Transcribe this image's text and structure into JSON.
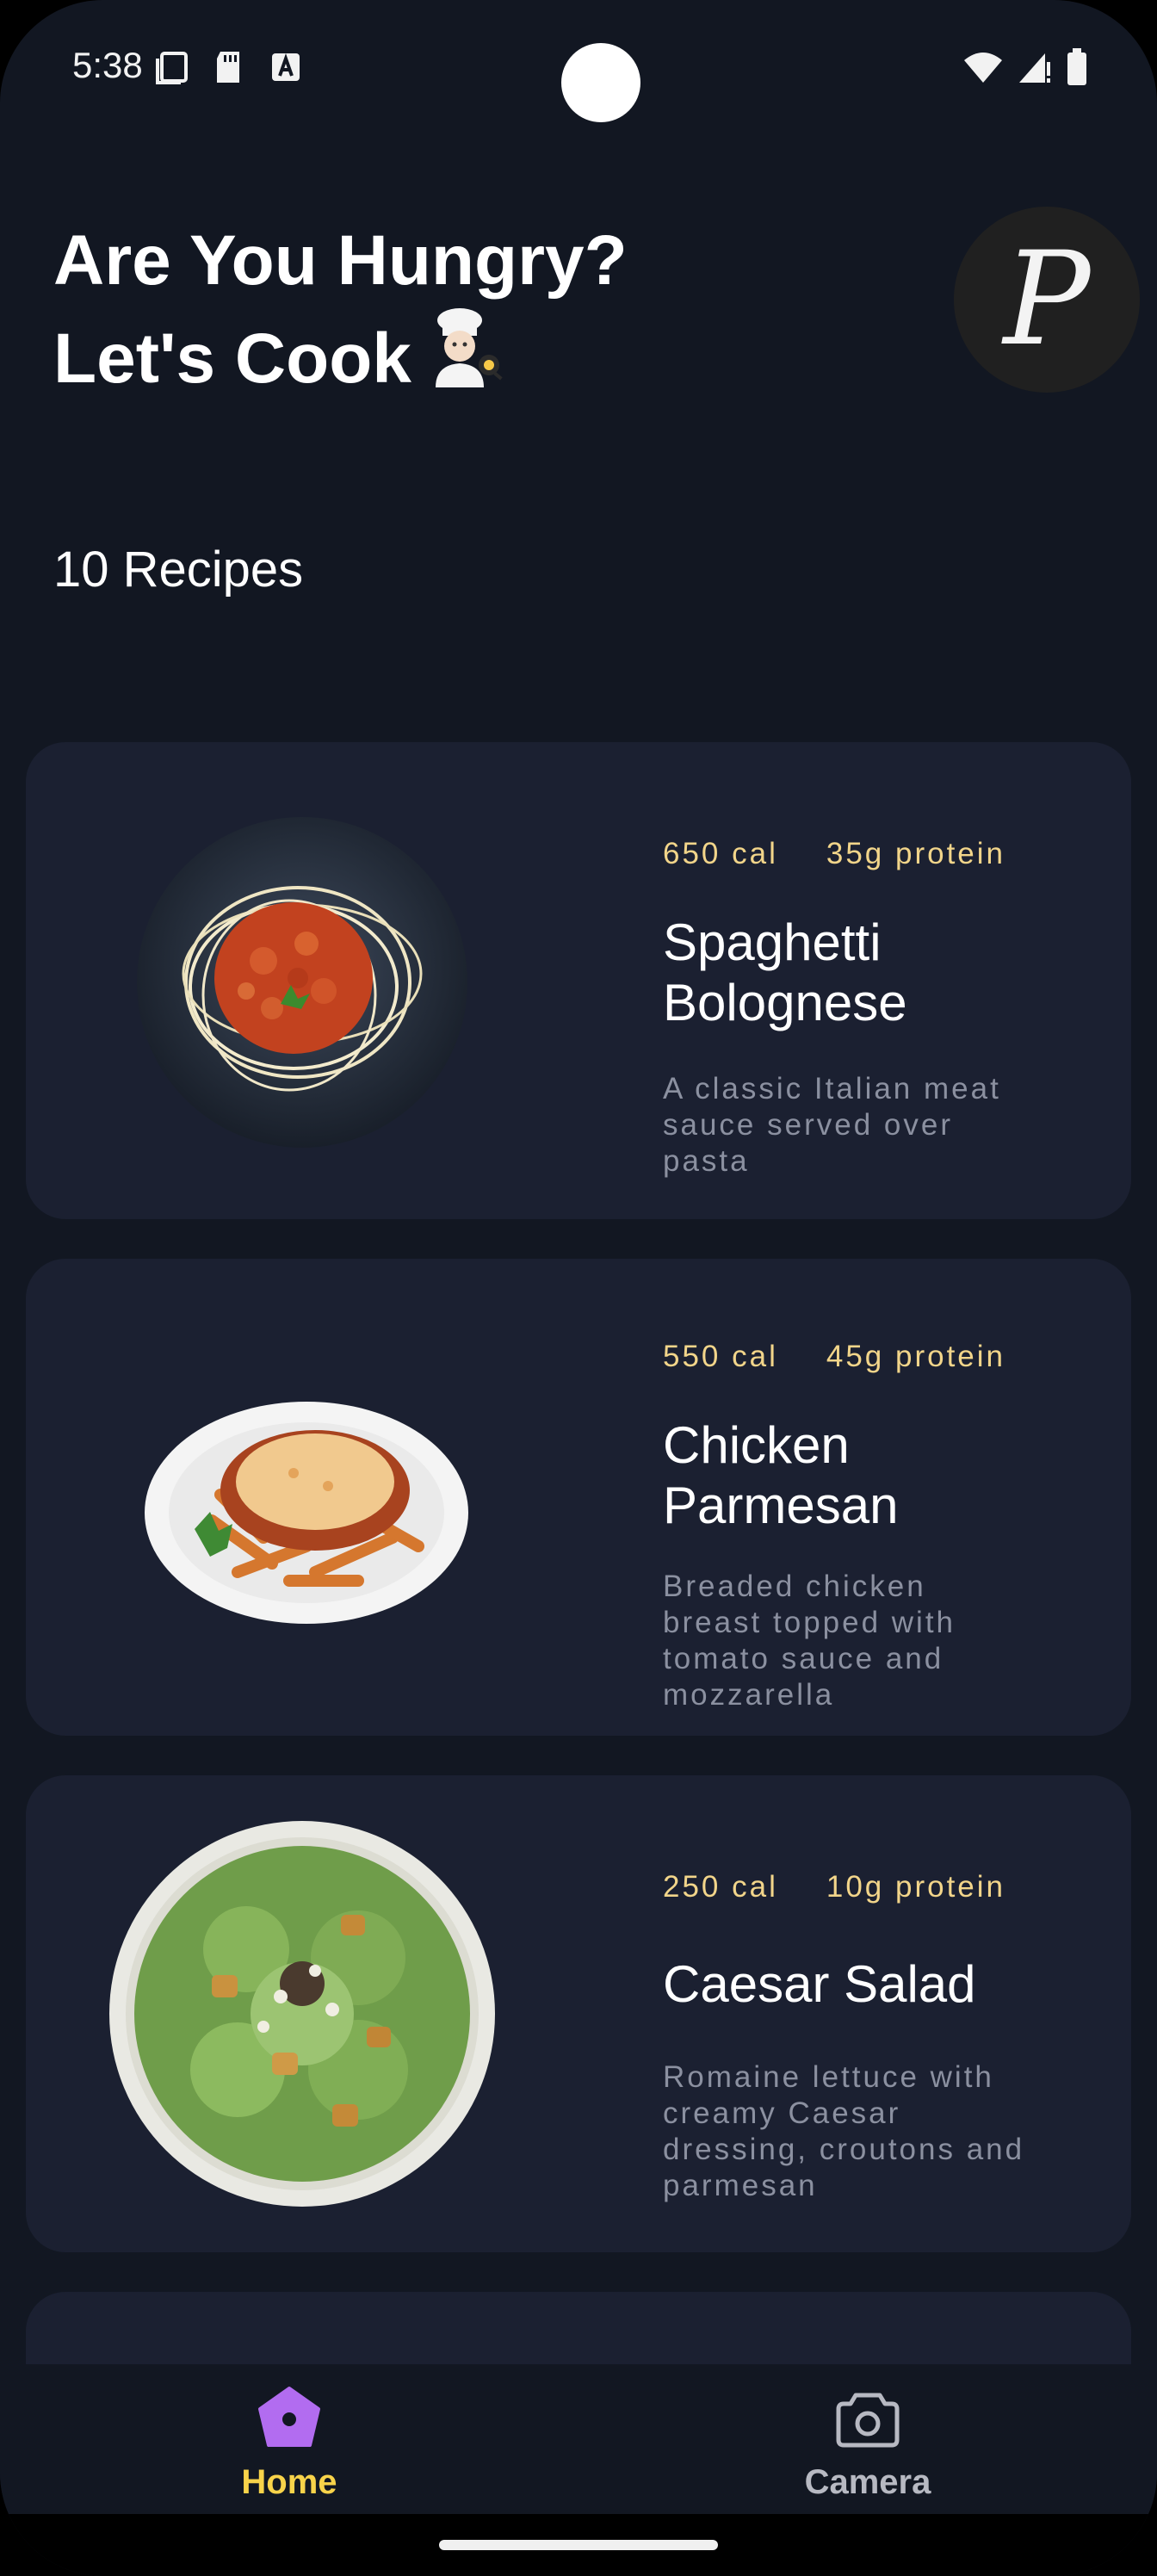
{
  "status_bar": {
    "time": "5:38"
  },
  "header": {
    "line1": "Are You Hungry?",
    "line2": "Let's Cook",
    "avatar_letter": "P"
  },
  "recipe_count": "10 Recipes",
  "recipes": [
    {
      "calories": "650 cal",
      "protein": "35g protein",
      "title_l1": "Spaghetti",
      "title_l2": "Bolognese",
      "desc_l1": "A classic Italian meat",
      "desc_l2": "sauce served over",
      "desc_l3": "pasta",
      "image": "spaghetti-bolognese-image"
    },
    {
      "calories": "550 cal",
      "protein": "45g protein",
      "title_l1": "Chicken",
      "title_l2": "Parmesan",
      "desc_l1": "Breaded chicken",
      "desc_l2": "breast topped with",
      "desc_l3": "tomato sauce and",
      "desc_l4": "mozzarella",
      "image": "chicken-parmesan-image"
    },
    {
      "calories": "250 cal",
      "protein": "10g protein",
      "title_l1": "Caesar Salad",
      "desc_l1": "Romaine lettuce with",
      "desc_l2": "creamy Caesar",
      "desc_l3": "dressing, croutons and",
      "desc_l4": "parmesan",
      "image": "caesar-salad-image"
    }
  ],
  "nav": {
    "home": "Home",
    "camera": "Camera",
    "active_color": "#f8d34a",
    "home_icon_color": "#b26cf0",
    "inactive_color": "#b7b9c2"
  },
  "colors": {
    "background": "#121722",
    "card": "#1b2031",
    "meta_text": "#f2d58a"
  }
}
